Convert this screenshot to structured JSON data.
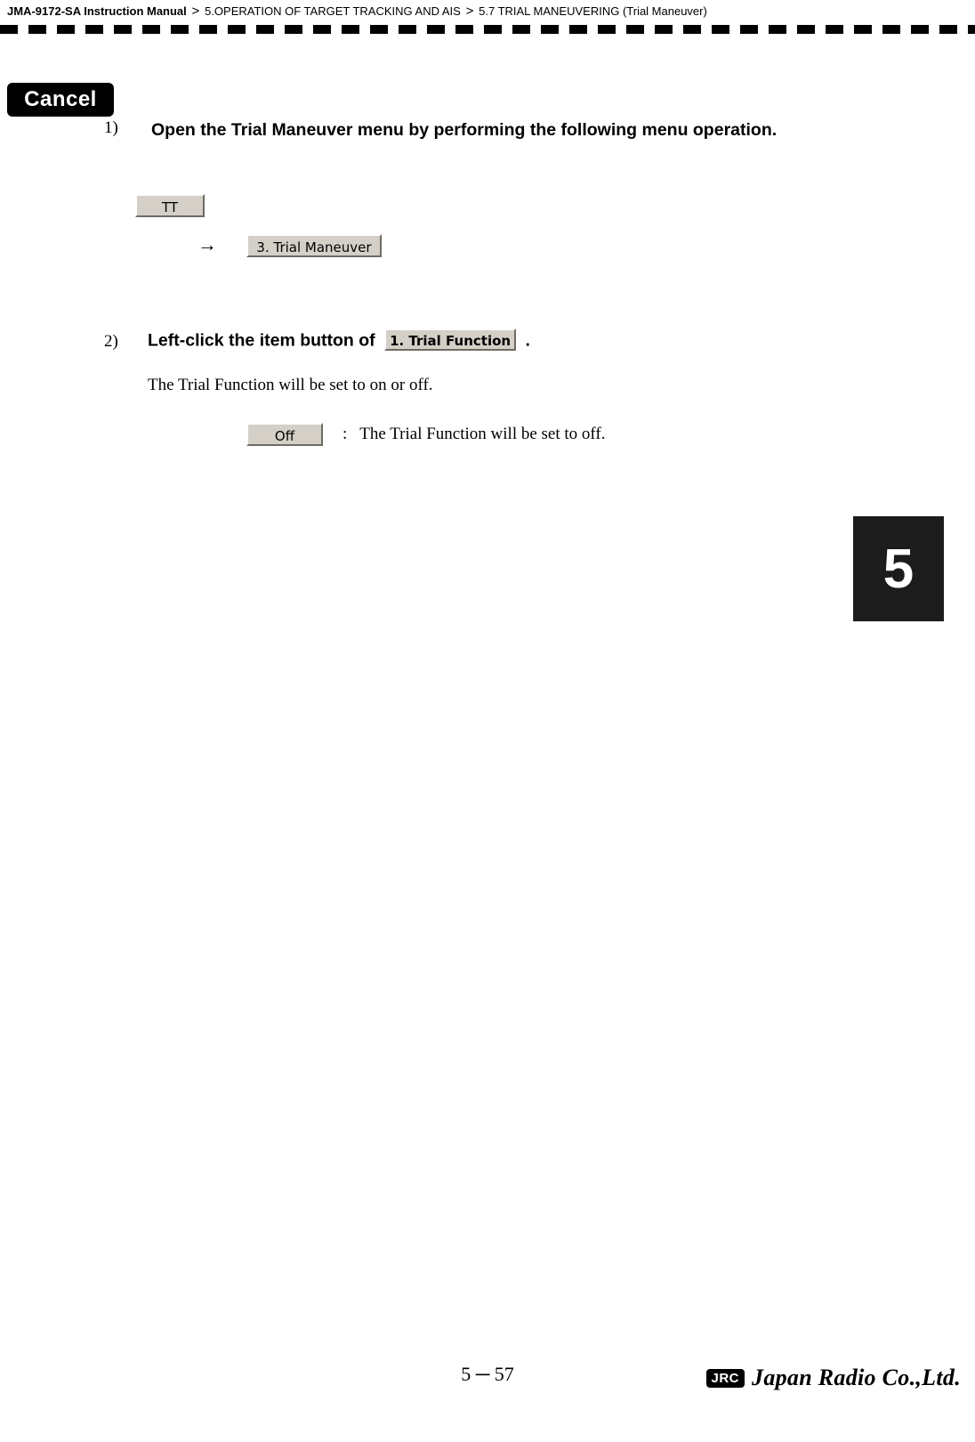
{
  "header": {
    "manual_title": "JMA-9172-SA Instruction Manual",
    "separator": ">",
    "chapter": "5.OPERATION OF TARGET TRACKING AND AIS",
    "section": "5.7  TRIAL MANEUVERING (Trial Maneuver)"
  },
  "cancel_tag": {
    "label": "Cancel"
  },
  "chapter_tab": {
    "number": "5"
  },
  "steps": [
    {
      "number": "1)",
      "text": "Open the Trial Maneuver menu by performing the following menu operation."
    },
    {
      "number": "2)",
      "text_before": "Left-click the item button of",
      "button_label": "1. Trial Function",
      "text_after": ".",
      "description": "The Trial Function will be set to on or off."
    }
  ],
  "menu_path": {
    "button_tt": "TT",
    "arrow": "→",
    "button_trial_maneuver": "3. Trial Maneuver"
  },
  "setting_row": {
    "button_off": "Off",
    "colon": ":",
    "description": "The Trial Function will be set to  off."
  },
  "footer": {
    "page": "5 ─ 57",
    "logo_mark": "JRC",
    "company": "Japan Radio Co.,Ltd."
  }
}
